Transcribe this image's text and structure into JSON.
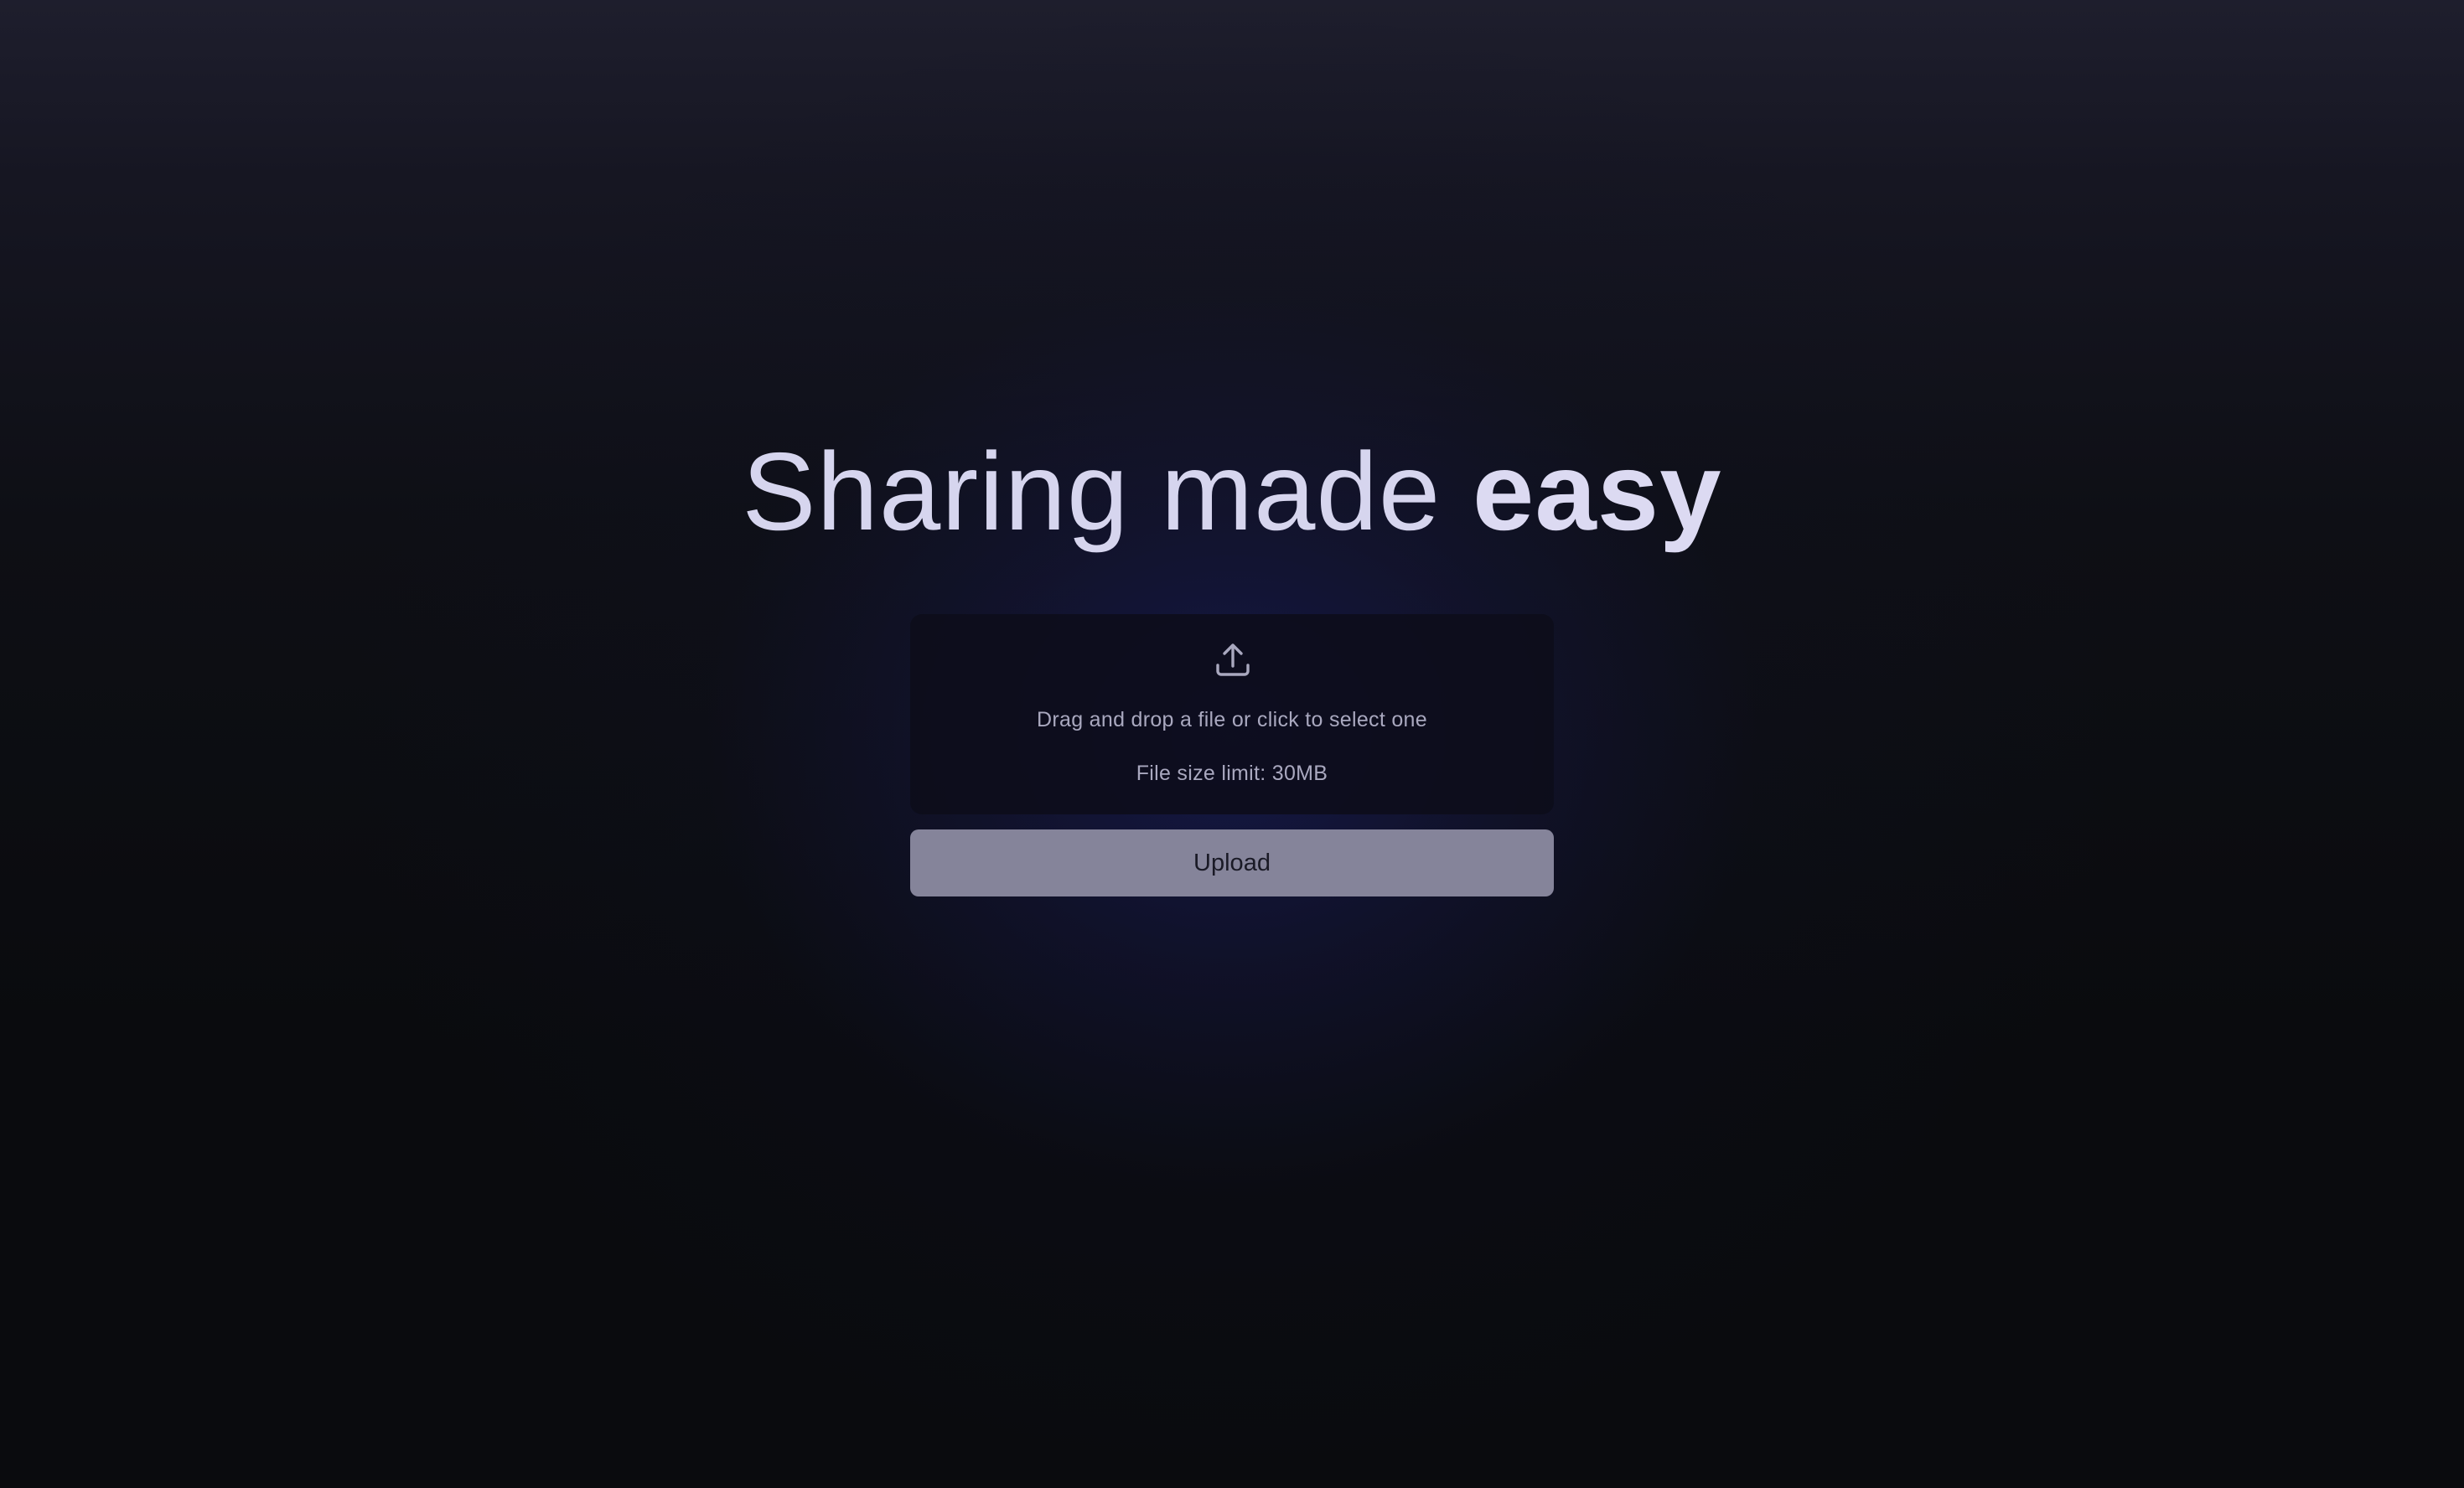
{
  "hero": {
    "title_regular": "Sharing made ",
    "title_bold": "easy"
  },
  "dropzone": {
    "icon": "upload-icon",
    "hint": "Drag and drop a file or click to select one",
    "limit": "File size limit: 30MB"
  },
  "actions": {
    "upload_label": "Upload"
  },
  "colors": {
    "title": "#d9d8f0",
    "dropzone_bg": "#0c0d1a",
    "button_bg": "#85849a",
    "button_text": "#1a1a26",
    "glow": "#181c5c"
  }
}
